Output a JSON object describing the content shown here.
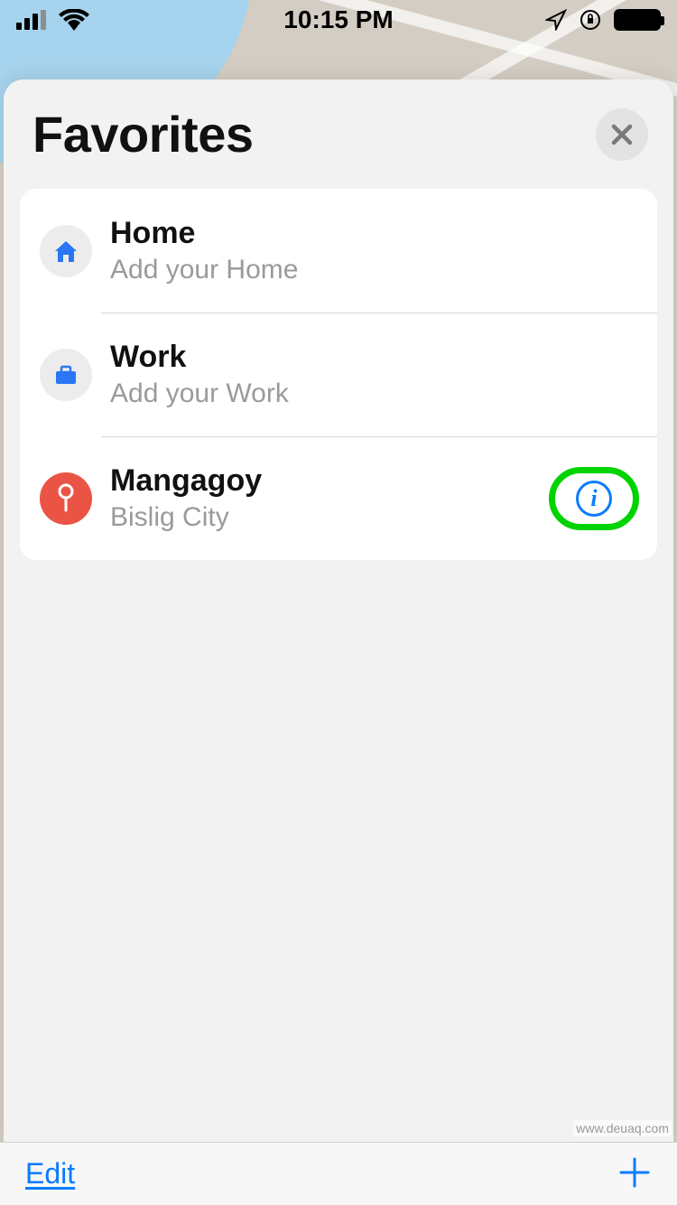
{
  "status_bar": {
    "time": "10:15 PM"
  },
  "sheet": {
    "title": "Favorites"
  },
  "favorites": [
    {
      "title": "Home",
      "subtitle": "Add your Home",
      "icon": "home-icon",
      "icon_bg": "gray",
      "has_info": false
    },
    {
      "title": "Work",
      "subtitle": "Add your Work",
      "icon": "briefcase-icon",
      "icon_bg": "gray",
      "has_info": false
    },
    {
      "title": "Mangagoy",
      "subtitle": "Bislig City",
      "icon": "pin-icon",
      "icon_bg": "red",
      "has_info": true,
      "highlight_info": true
    }
  ],
  "toolbar": {
    "edit_label": "Edit"
  },
  "watermark": "www.deuaq.com"
}
